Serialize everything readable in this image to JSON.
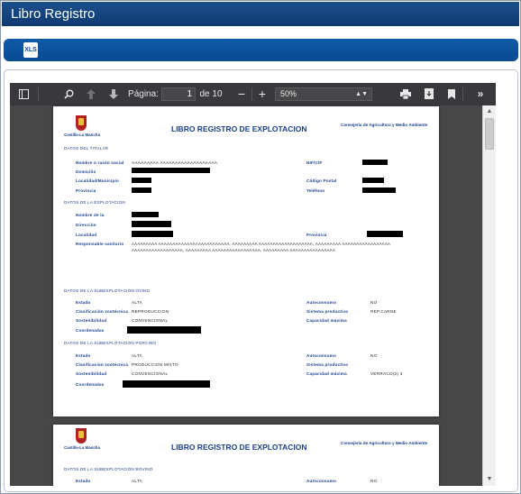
{
  "window": {
    "title": "Libro Registro"
  },
  "actions": {
    "export_label": "XLS"
  },
  "pdf_toolbar": {
    "page_label": "Página:",
    "current_page": "1",
    "page_total": "de 10",
    "zoom": "50%",
    "icons": [
      "sidebar-toggle-icon",
      "search-icon",
      "previous-page-icon",
      "next-page-icon",
      "zoom-out-icon",
      "zoom-in-icon",
      "print-icon",
      "download-icon",
      "bookmark-icon",
      "tools-icon"
    ]
  },
  "document": {
    "logo_text": "Castilla-La Mancha",
    "title": "LIBRO REGISTRO DE EXPLOTACION",
    "consejeria": "Consejería de Agricultura y Medio Ambiente",
    "titular": {
      "section": "DATOS DEL TITULAR",
      "nombre_label": "Nombre o razón social",
      "nombre_value": "AAAAAAAAA AAAAAAAAAAAAAAAAAAA",
      "domicilio_label": "Domicilio",
      "localidad_label": "Localidad/Municipio",
      "provincia_label": "Provincia",
      "nif_label": "NIF/CIF",
      "cp_label": "Código Postal",
      "telefono_label": "Teléfono"
    },
    "explotacion": {
      "section": "DATOS DE LA EXPLOTACION",
      "nombre_label": "Nombre de la",
      "direccion_label": "Dirección",
      "localidad_label": "Localidad",
      "provincia_label": "Provincia",
      "responsable_label": "Responsable sanitario",
      "responsable_line1": "AAAAAAAAA AAAAAAAAAAAAAAAAAAAAAAAAA, AAAAAAAAA AAAAAAAAAAAAAAAAAAA, AAAAAAAAA AAAAAAAAAAAAAAAAA",
      "responsable_line2": "AAAAAAAAAAAAAAAAAA, AAAAAAAAA AAAAAAAAAAAAAAAAA, AAAAAAAAA AAAAAAAAAAAAAAAA"
    },
    "ovino": {
      "section": "DATOS DE LA SUBEXPLOTACIÓN OVINO",
      "estado_label": "Estado",
      "estado_value": "ALTA",
      "clasificacion_label": "Clasificación zootécnica",
      "clasificacion_value": "REPRODUCCION",
      "sostenibilidad_label": "Sostenibilidad",
      "sostenibilidad_value": "CONVENCIONAL",
      "coordenadas_label": "Coordenadas",
      "autoconsumo_label": "Autoconsumo",
      "autoconsumo_value": "NO",
      "sistema_label": "Sistema productivo",
      "sistema_value": "REP.CARNE",
      "capacidad_label": "Capacidad máxima"
    },
    "porcino": {
      "section": "DATOS DE LA SUBEXPLOTACIÓN PORCINO",
      "estado_label": "Estado",
      "estado_value": "ALTA",
      "clasificacion_label": "Clasificación zootécnica",
      "clasificacion_value": "PRODUCCION MIXTO",
      "sostenibilidad_label": "Sostenibilidad",
      "sostenibilidad_value": "CONVENCIONAL",
      "coordenadas_label": "Coordenadas",
      "autoconsumo_label": "Autoconsumo",
      "autoconsumo_value": "NO",
      "sistema_label": "Sistema productivo",
      "capacidad_label": "Capacidad máxima",
      "capacidad_value": "VERRACO(2) 3"
    },
    "page2": {
      "title": "LIBRO REGISTRO DE EXPLOTACION",
      "consejeria": "Consejería de Agricultura y Medio Ambiente",
      "section": "DATOS DE LA SUBEXPLOTACIÓN BOVINO",
      "estado_label": "Estado",
      "estado_value": "ALTA",
      "autoconsumo_label": "Autoconsumo",
      "autoconsumo_value": "NO"
    }
  }
}
